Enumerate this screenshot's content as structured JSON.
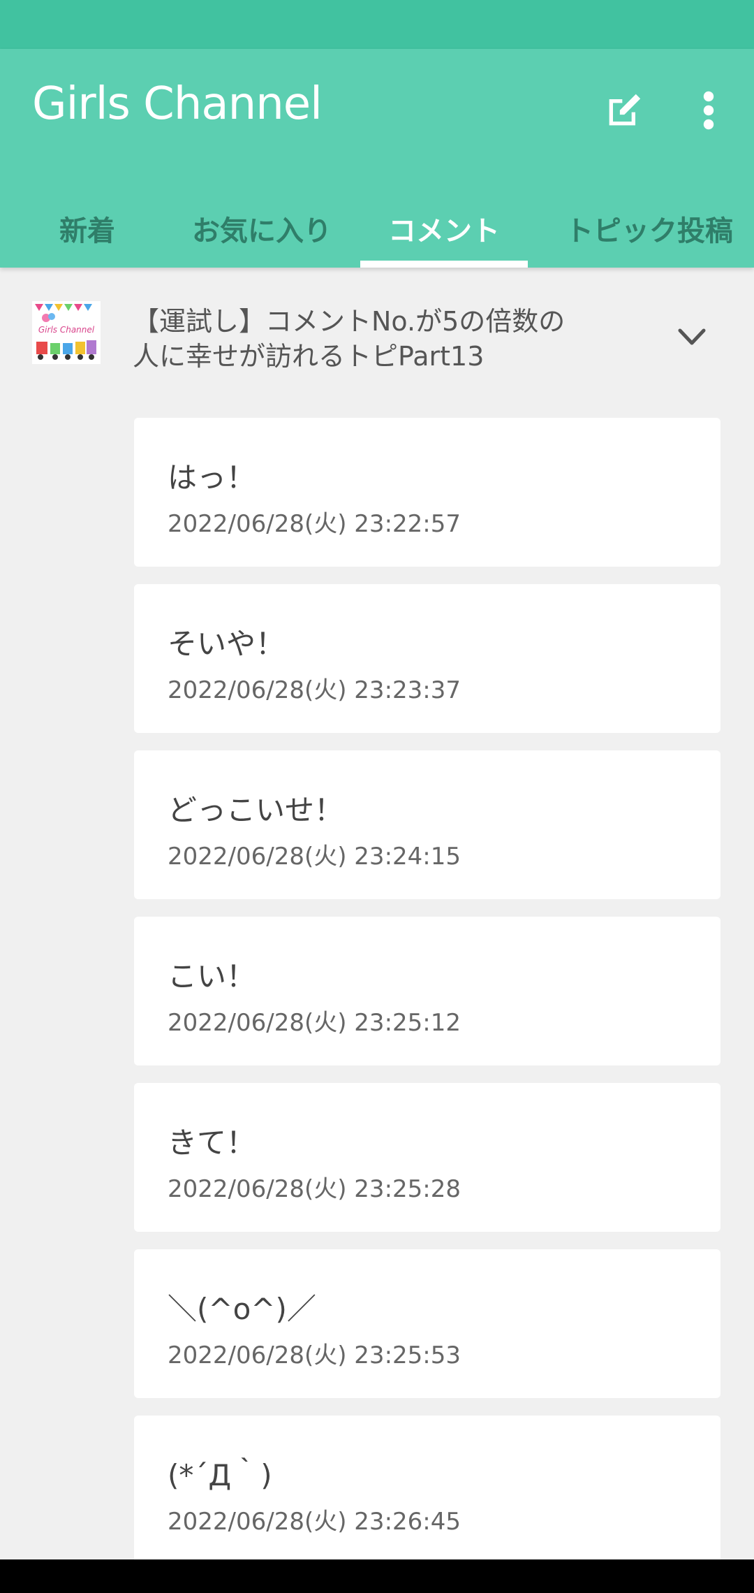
{
  "app": {
    "title": "Girls Channel",
    "colors": {
      "status_bar": "#41c2a0",
      "app_bar": "#5ccfb1",
      "tab_inactive": "#2f7e69",
      "background": "#f0f0f0"
    }
  },
  "toolbar": {
    "edit_icon": "edit-icon",
    "more_icon": "more-vert-icon"
  },
  "tabs": [
    {
      "label": "新着"
    },
    {
      "label": "お気に入り"
    },
    {
      "label": "コメント",
      "active": true
    },
    {
      "label": "トピック投稿"
    }
  ],
  "topic": {
    "title_line1": "【運試し】コメントNo.が5の倍数の",
    "title_line2": "人に幸せが訪れるトピPart13",
    "thumbnail_text": "Girls Channel"
  },
  "comments": [
    {
      "text": "はっ！",
      "time": "2022/06/28(火) 23:22:57"
    },
    {
      "text": "そいや！",
      "time": "2022/06/28(火) 23:23:37"
    },
    {
      "text": "どっこいせ！",
      "time": "2022/06/28(火) 23:24:15"
    },
    {
      "text": "こい！",
      "time": "2022/06/28(火) 23:25:12"
    },
    {
      "text": "きて！",
      "time": "2022/06/28(火) 23:25:28"
    },
    {
      "text": "＼(^o^)／",
      "time": "2022/06/28(火) 23:25:53"
    },
    {
      "text": "(*´Д｀)",
      "time": "2022/06/28(火) 23:26:45"
    }
  ]
}
